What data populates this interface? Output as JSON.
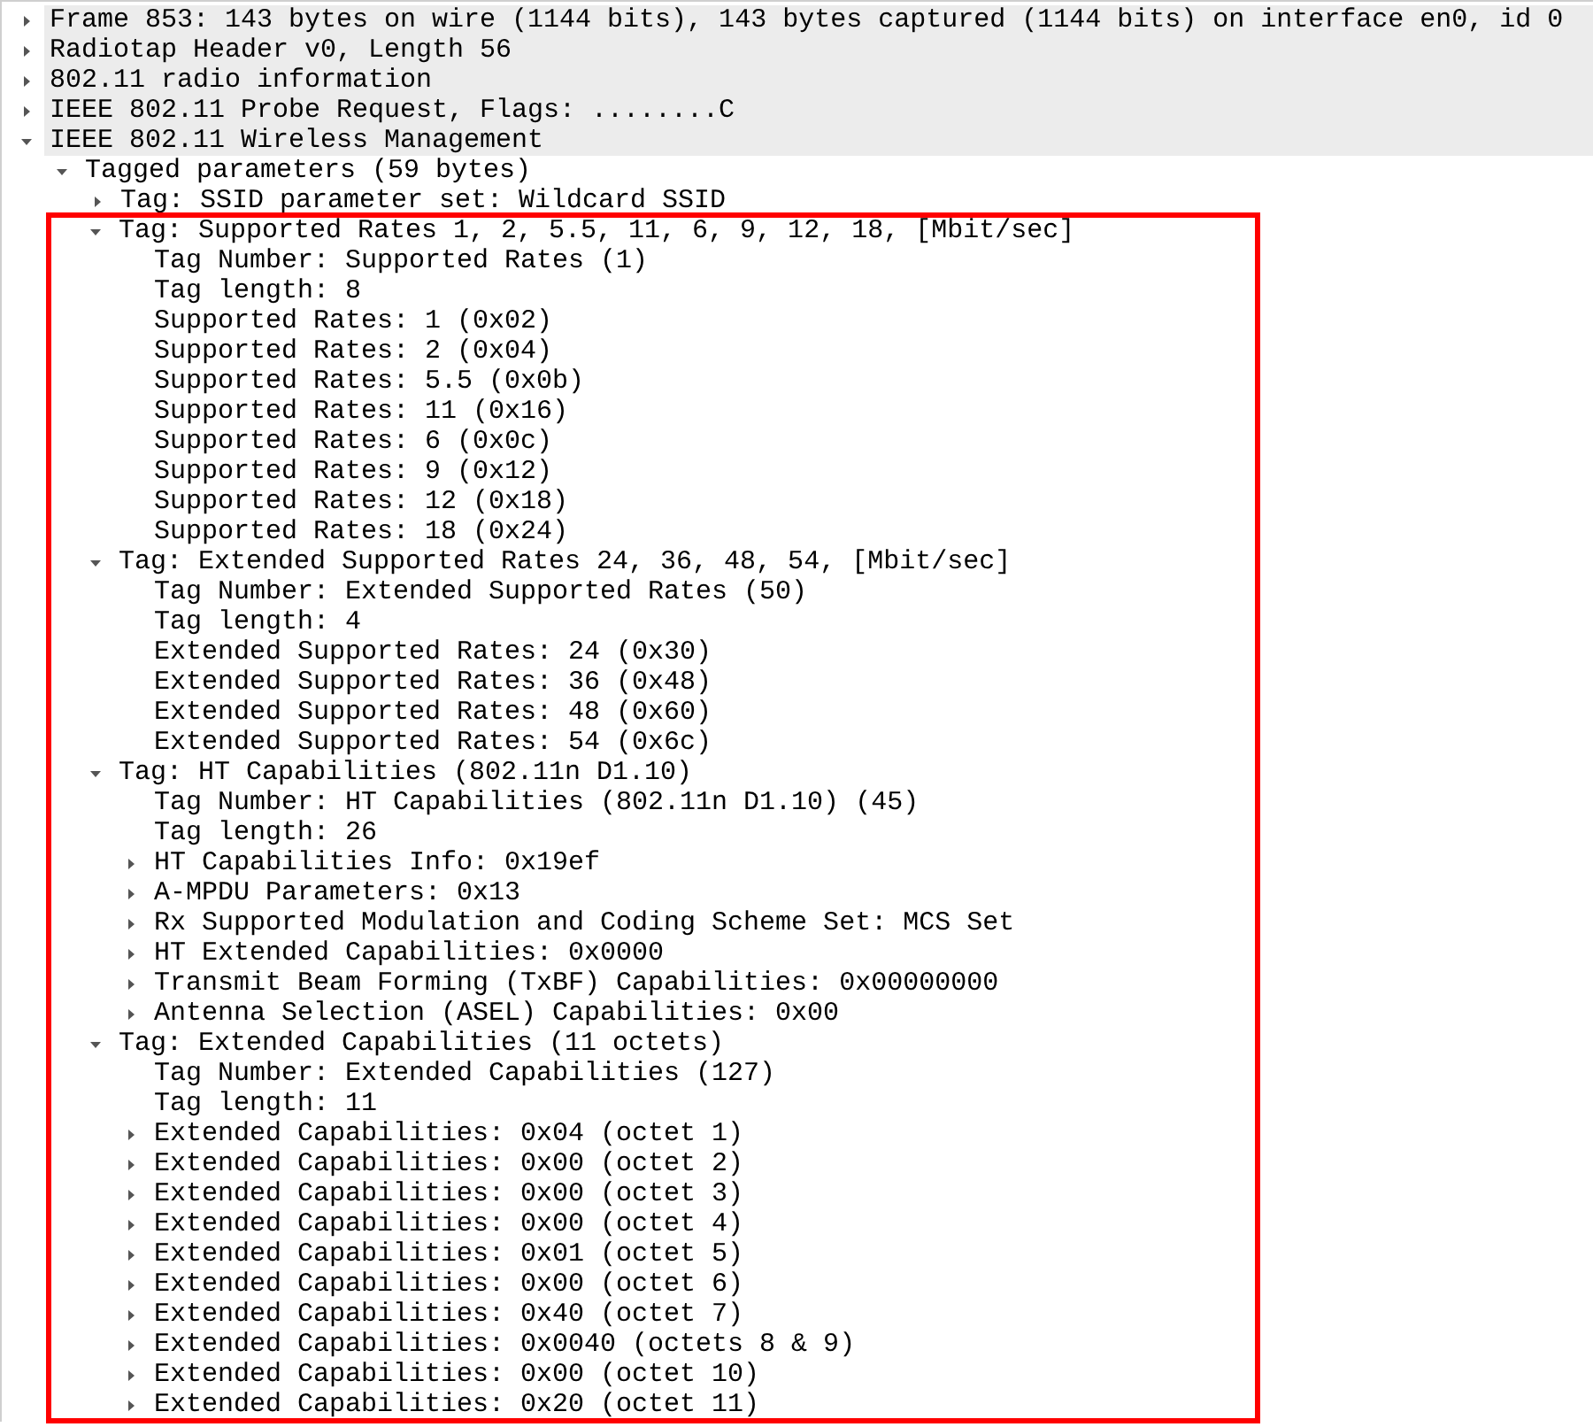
{
  "tree": [
    {
      "label": "Frame 853: 143 bytes on wire (1144 bits), 143 bytes captured (1144 bits) on interface en0, id 0",
      "expanded": false
    },
    {
      "label": "Radiotap Header v0, Length 56",
      "expanded": false
    },
    {
      "label": "802.11 radio information",
      "expanded": false
    },
    {
      "label": "IEEE 802.11 Probe Request, Flags: ........C",
      "expanded": false
    },
    {
      "label": "IEEE 802.11 Wireless Management",
      "expanded": true,
      "children": [
        {
          "label": "Tagged parameters (59 bytes)",
          "expanded": true,
          "children": [
            {
              "label": "Tag: SSID parameter set: Wildcard SSID",
              "expanded": false,
              "highlighted": false
            },
            {
              "label": "Tag: Supported Rates 1, 2, 5.5, 11, 6, 9, 12, 18, [Mbit/sec]",
              "expanded": true,
              "highlighted": true,
              "children": [
                {
                  "label": "Tag Number: Supported Rates (1)"
                },
                {
                  "label": "Tag length: 8"
                },
                {
                  "label": "Supported Rates: 1 (0x02)"
                },
                {
                  "label": "Supported Rates: 2 (0x04)"
                },
                {
                  "label": "Supported Rates: 5.5 (0x0b)"
                },
                {
                  "label": "Supported Rates: 11 (0x16)"
                },
                {
                  "label": "Supported Rates: 6 (0x0c)"
                },
                {
                  "label": "Supported Rates: 9 (0x12)"
                },
                {
                  "label": "Supported Rates: 12 (0x18)"
                },
                {
                  "label": "Supported Rates: 18 (0x24)"
                }
              ]
            },
            {
              "label": "Tag: Extended Supported Rates 24, 36, 48, 54, [Mbit/sec]",
              "expanded": true,
              "highlighted": true,
              "children": [
                {
                  "label": "Tag Number: Extended Supported Rates (50)"
                },
                {
                  "label": "Tag length: 4"
                },
                {
                  "label": "Extended Supported Rates: 24 (0x30)"
                },
                {
                  "label": "Extended Supported Rates: 36 (0x48)"
                },
                {
                  "label": "Extended Supported Rates: 48 (0x60)"
                },
                {
                  "label": "Extended Supported Rates: 54 (0x6c)"
                }
              ]
            },
            {
              "label": "Tag: HT Capabilities (802.11n D1.10)",
              "expanded": true,
              "highlighted": true,
              "children": [
                {
                  "label": "Tag Number: HT Capabilities (802.11n D1.10) (45)"
                },
                {
                  "label": "Tag length: 26"
                },
                {
                  "label": "HT Capabilities Info: 0x19ef",
                  "expanded": false
                },
                {
                  "label": "A-MPDU Parameters: 0x13",
                  "expanded": false
                },
                {
                  "label": "Rx Supported Modulation and Coding Scheme Set: MCS Set",
                  "expanded": false
                },
                {
                  "label": "HT Extended Capabilities: 0x0000",
                  "expanded": false
                },
                {
                  "label": "Transmit Beam Forming (TxBF) Capabilities: 0x00000000",
                  "expanded": false
                },
                {
                  "label": "Antenna Selection (ASEL) Capabilities: 0x00",
                  "expanded": false
                }
              ]
            },
            {
              "label": "Tag: Extended Capabilities (11 octets)",
              "expanded": true,
              "highlighted": true,
              "children": [
                {
                  "label": "Tag Number: Extended Capabilities (127)"
                },
                {
                  "label": "Tag length: 11"
                },
                {
                  "label": "Extended Capabilities: 0x04 (octet 1)",
                  "expanded": false
                },
                {
                  "label": "Extended Capabilities: 0x00 (octet 2)",
                  "expanded": false
                },
                {
                  "label": "Extended Capabilities: 0x00 (octet 3)",
                  "expanded": false
                },
                {
                  "label": "Extended Capabilities: 0x00 (octet 4)",
                  "expanded": false
                },
                {
                  "label": "Extended Capabilities: 0x01 (octet 5)",
                  "expanded": false
                },
                {
                  "label": "Extended Capabilities: 0x00 (octet 6)",
                  "expanded": false
                },
                {
                  "label": "Extended Capabilities: 0x40 (octet 7)",
                  "expanded": false
                },
                {
                  "label": "Extended Capabilities: 0x0040 (octets 8 & 9)",
                  "expanded": false
                },
                {
                  "label": "Extended Capabilities: 0x00 (octet 10)",
                  "expanded": false
                },
                {
                  "label": "Extended Capabilities: 0x20 (octet 11)",
                  "expanded": false
                }
              ]
            }
          ]
        }
      ]
    }
  ]
}
